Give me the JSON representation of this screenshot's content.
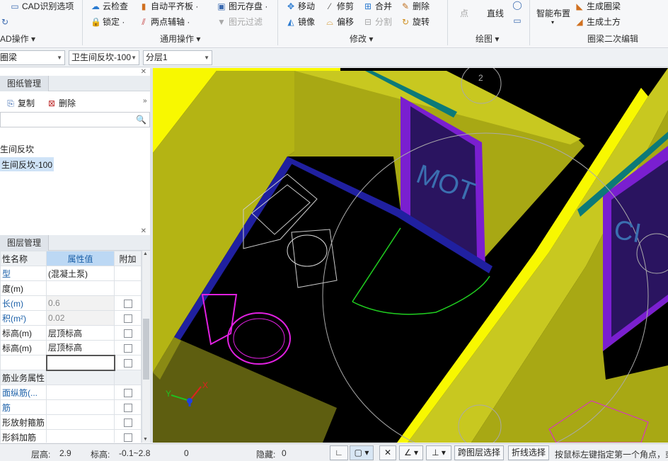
{
  "ribbon": {
    "cad_identify": "CAD识别选项",
    "cad_ops_group": "AD操作 ▾",
    "cloud_check": "云检查",
    "lock": "锁定 ·",
    "auto_level": "自动平齐板 ·",
    "two_point_axis": "两点辅轴 ·",
    "save_element": "图元存盘 ·",
    "filter_element": "图元过滤",
    "common_group": "通用操作 ▾",
    "move": "移动",
    "trim": "修剪",
    "merge": "合并",
    "delete": "删除",
    "mirror": "镜像",
    "offset": "偏移",
    "split": "分割",
    "rotate": "旋转",
    "modify_group": "修改 ▾",
    "point": "点",
    "line": "直线",
    "draw_group": "绘图 ▾",
    "smart_layout": "智能布置",
    "smart_layout_arrow": "▾",
    "gen_ring_beam": "生成圈梁",
    "gen_earthwork": "生成土方",
    "ring_beam_group": "圈梁二次编辑"
  },
  "toolbar": {
    "element_type": "圈梁",
    "element_name": "卫生间反坎-100",
    "floor": "分层1"
  },
  "drawing_panel": {
    "tab": "图纸管理",
    "copy": "复制",
    "delete": "删除",
    "tree_items": [
      "生间反坎",
      "生间反坎-100"
    ]
  },
  "layer_panel": {
    "tab": "图层管理"
  },
  "properties": {
    "header": [
      "性名称",
      "属性值",
      "附加"
    ],
    "rows": [
      {
        "name": "型",
        "value": "(混凝土泵)",
        "check": false,
        "blue": true
      },
      {
        "name": "度(m)",
        "value": "",
        "check": false
      },
      {
        "name": "长(m)",
        "value": "0.6",
        "check": true,
        "blue": true,
        "grey": true
      },
      {
        "name": "积(m²)",
        "value": "0.02",
        "check": true,
        "blue": true,
        "grey": true
      },
      {
        "name": "标高(m)",
        "value": "层顶标高",
        "check": true
      },
      {
        "name": "标高(m)",
        "value": "层顶标高",
        "check": true
      },
      {
        "name": "",
        "value": "",
        "check": true,
        "editing": true
      },
      {
        "name": "筋业务属性",
        "value": "",
        "check": false,
        "section": true
      },
      {
        "name": "面纵筋(...",
        "value": "",
        "check": true,
        "blue": true
      },
      {
        "name": "筋",
        "value": "",
        "check": true,
        "blue": true
      },
      {
        "name": "形放射箍筋",
        "value": "",
        "check": true
      },
      {
        "name": "形斜加筋",
        "value": "",
        "check": true
      }
    ]
  },
  "viewport": {
    "letters_left": "MOT",
    "letters_right": "CI",
    "axis_x": "X",
    "axis_y": "Y",
    "marker_2": "2"
  },
  "status": {
    "floor_height_label": "层高:",
    "floor_height": "2.9",
    "elevation_label": "标高:",
    "elevation": "-0.1~2.8",
    "count": "0",
    "hidden_label": "隐藏:",
    "hidden": "0",
    "cross_layer_select": "跨图层选择",
    "polyline_select": "折线选择",
    "hint": "按鼠标左键指定第一个角点，或"
  },
  "colors": {
    "wall_yellow": "#c8c820",
    "wall_top": "#f8f800",
    "floor_blue": "#2020a0",
    "window_purple": "#7a1fd0",
    "teal": "#0c7a78",
    "magenta": "#e020e0",
    "green": "#20d020"
  }
}
